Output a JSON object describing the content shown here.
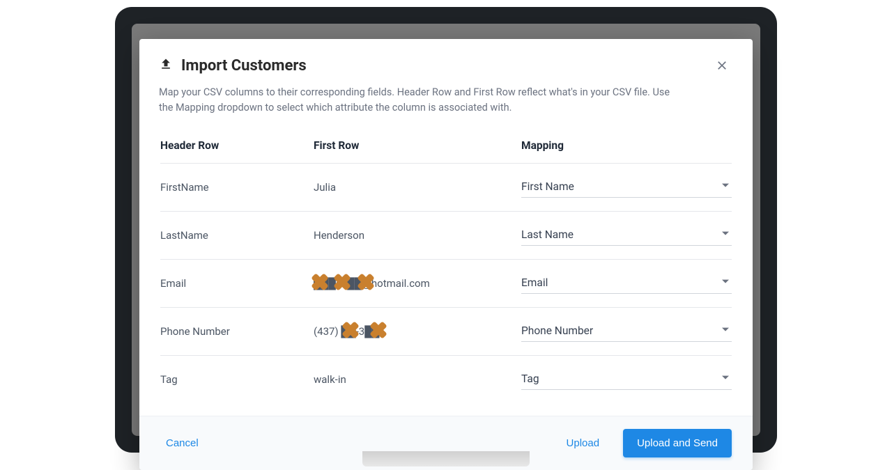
{
  "modal": {
    "title": "Import Customers",
    "description": "Map your CSV columns to their corresponding fields. Header Row and First Row reflect what's in your CSV file. Use the Mapping dropdown to select which attribute the column is associated with.",
    "columns": {
      "header": "Header Row",
      "first": "First Row",
      "mapping": "Mapping"
    },
    "rows": [
      {
        "header": "FirstName",
        "first": "Julia",
        "mapping": "First Name",
        "first_redacted": false
      },
      {
        "header": "LastName",
        "first": "Henderson",
        "mapping": "Last Name",
        "first_redacted": false
      },
      {
        "header": "Email",
        "first": "███so██@hotmail.com",
        "mapping": "Email",
        "first_redacted": true
      },
      {
        "header": "Phone Number",
        "first": "(437) ██-3██",
        "mapping": "Phone Number",
        "first_redacted": true
      },
      {
        "header": "Tag",
        "first": "walk-in",
        "mapping": "Tag",
        "first_redacted": false
      }
    ]
  },
  "footer": {
    "cancel": "Cancel",
    "upload": "Upload",
    "upload_send": "Upload and Send"
  },
  "colors": {
    "primary": "#1e88e5",
    "redact": "#c9802e"
  }
}
